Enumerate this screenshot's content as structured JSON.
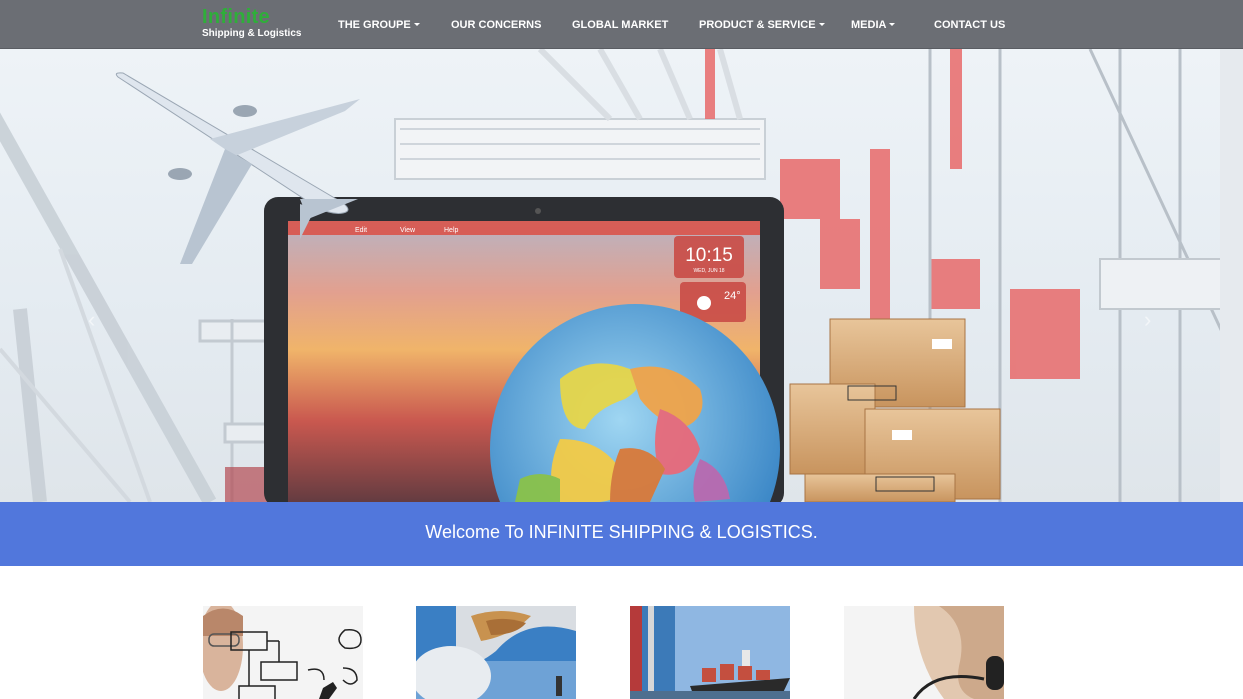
{
  "logo": {
    "main": "Infinite",
    "sub": "Shipping & Logistics"
  },
  "nav": {
    "groupe": "THE GROUPE",
    "concerns": "OUR CONCERNS",
    "global": "GLOBAL MARKET",
    "product": "PRODUCT & SERVICE",
    "media": "MEDIA",
    "contact": "CONTACT US"
  },
  "hero": {
    "screen_menu": [
      "Edit",
      "View",
      "Help"
    ],
    "clock_time": "10:15",
    "clock_date": "WED, JUN 18",
    "temperature": "24°"
  },
  "welcome": {
    "text": "Welcome To INFINITE SHIPPING & LOGISTICS."
  },
  "colors": {
    "navbar": "#6b6e74",
    "logo_green": "#2fae3a",
    "welcome_band": "#5177dc"
  },
  "thumbnails": [
    {
      "icon": "flowchart-photo"
    },
    {
      "icon": "cargo-plane-photo"
    },
    {
      "icon": "container-ship-photo"
    },
    {
      "icon": "headset-person-photo"
    }
  ]
}
